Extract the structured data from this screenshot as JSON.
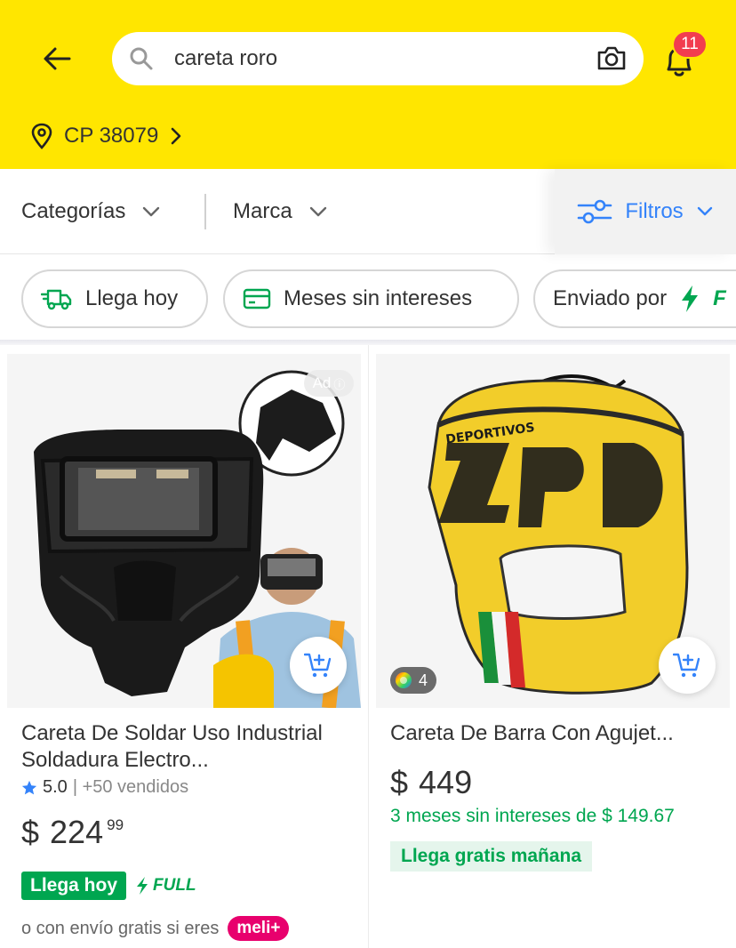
{
  "header": {
    "search_query": "careta roro",
    "notifications_count": "11",
    "location_label": "CP 38079"
  },
  "filters": {
    "categories_label": "Categorías",
    "brand_label": "Marca",
    "filters_label": "Filtros"
  },
  "chips": [
    {
      "label": "Llega hoy"
    },
    {
      "label": "Meses sin intereses"
    },
    {
      "label": "Enviado por"
    }
  ],
  "products": [
    {
      "title": "Careta De Soldar Uso Industrial Soldadura Electro...",
      "ad_label": "Ad",
      "rating": "5.0",
      "sold": "| +50 vendidos",
      "currency": "$",
      "price": "224",
      "price_cents": "99",
      "shipping_label": "Llega hoy",
      "full_label": "FULL",
      "meli_text": "o con envío gratis si eres",
      "meli_badge": "meli+"
    },
    {
      "title": "Careta De Barra Con Agujet...",
      "colors_count": "4",
      "currency": "$",
      "price": "449",
      "installments": "3 meses sin intereses de $ 149.67",
      "shipping_label": "Llega gratis mañana"
    }
  ],
  "colors": {
    "brand_yellow": "#ffe600",
    "accent_blue": "#3483fa",
    "green": "#00a650",
    "badge_red": "#f23d4f",
    "meli_pink": "#e8006d"
  }
}
